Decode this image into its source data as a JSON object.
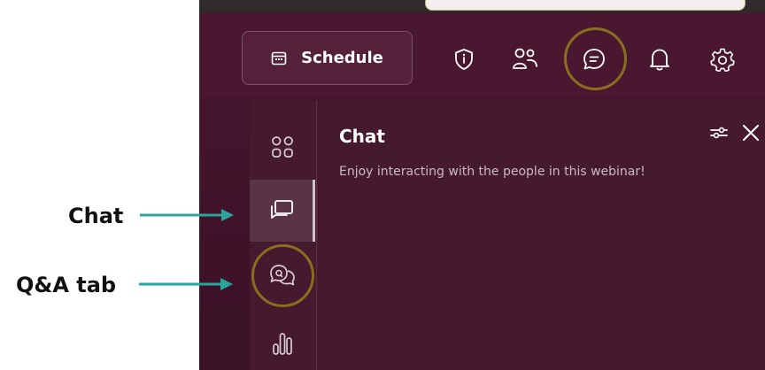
{
  "header": {
    "schedule_label": "Schedule",
    "icons": [
      "calendar-icon",
      "info-shield-icon",
      "people-icon",
      "chat-icon",
      "bell-icon",
      "gear-icon"
    ]
  },
  "chat_panel": {
    "title": "Chat",
    "subtitle": "Enjoy interacting with the people in this webinar!",
    "rail_icons": [
      "apps-icon",
      "chat-rail-icon",
      "qa-icon",
      "polls-icon"
    ]
  },
  "annotations": {
    "chat_label": "Chat",
    "qa_label": "Q&A tab"
  },
  "colors": {
    "background": "#4a1730",
    "panel": "#45192e",
    "highlight": "#8a6d1d",
    "arrow": "#2aa59a"
  }
}
